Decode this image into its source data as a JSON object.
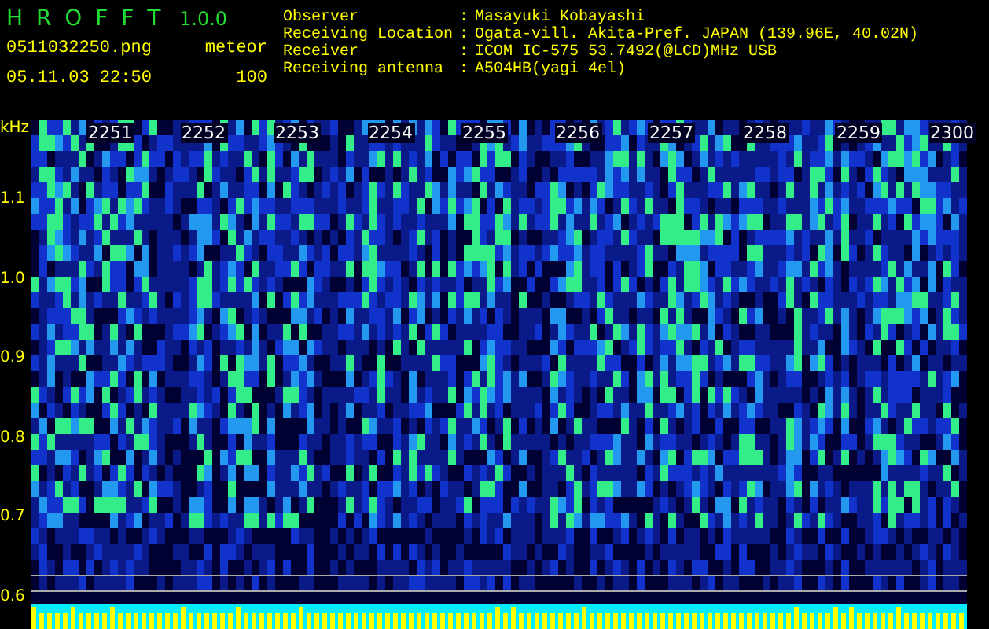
{
  "app": {
    "title": "H R O F F T",
    "version": "1.0.0"
  },
  "file": {
    "name": "0511032250.png",
    "datetime": "05.11.03 22:50"
  },
  "meteor": {
    "label": "meteor",
    "count": "100"
  },
  "info": [
    {
      "label": "Observer",
      "separator": ":",
      "value": "Masayuki Kobayashi"
    },
    {
      "label": "Receiving Location",
      "separator": ":",
      "value": "Ogata-vill. Akita-Pref. JAPAN (139.96E, 40.02N)"
    },
    {
      "label": "Receiver",
      "separator": ":",
      "value": "ICOM IC-575 53.7492(@LCD)MHz USB"
    },
    {
      "label": "Receiving antenna",
      "separator": ":",
      "value": "A504HB(yagi 4el)"
    }
  ],
  "axis": {
    "unit": "kHz",
    "frequency_ticks": [
      "1.1",
      "1.0",
      "0.9",
      "0.8",
      "0.7",
      "0.6"
    ]
  },
  "time_labels": [
    "2251",
    "2252",
    "2253",
    "2254",
    "2255",
    "2256",
    "2257",
    "2258",
    "2259",
    "2300"
  ]
}
